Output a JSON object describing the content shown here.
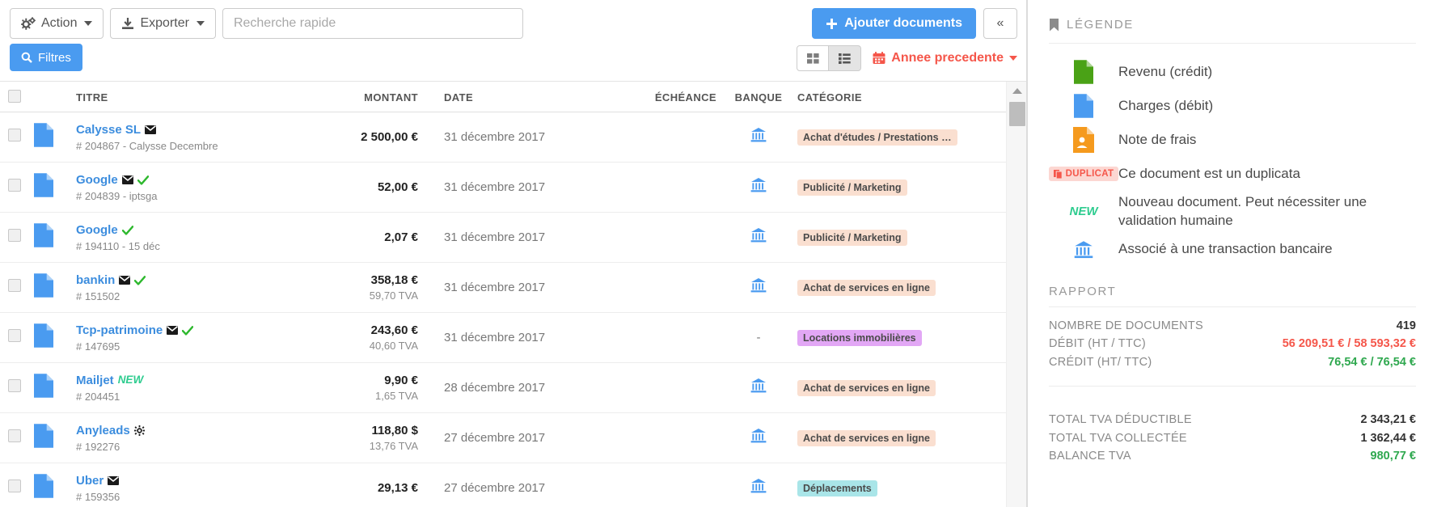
{
  "toolbar": {
    "action_label": "Action",
    "export_label": "Exporter",
    "search_placeholder": "Recherche rapide",
    "search_value": "",
    "add_documents_label": "Ajouter documents",
    "collapse_label": "«"
  },
  "filterbar": {
    "filter_label": "Filtres",
    "year_label": "Annee precedente",
    "view_grid": "grid-view",
    "view_list": "list-view"
  },
  "table": {
    "columns": [
      "TITRE",
      "MONTANT",
      "DATE",
      "ÉCHÉANCE",
      "BANQUE",
      "CATÉGORIE"
    ],
    "rows": [
      {
        "title": "Calysse SL",
        "flags": [
          "mail"
        ],
        "ref": "# 204867 -  Calysse Decembre",
        "amount": "2 500,00 €",
        "tva": "",
        "date": "31 décembre 2017",
        "echeance": "",
        "bank": "bank",
        "category": "Achat d'études / Prestations …",
        "category_color": "#fadfd0"
      },
      {
        "title": "Google",
        "flags": [
          "mail",
          "check"
        ],
        "ref": "# 204839 -  iptsga",
        "amount": "52,00 €",
        "tva": "",
        "date": "31 décembre 2017",
        "echeance": "",
        "bank": "bank",
        "category": "Publicité / Marketing",
        "category_color": "#fadfd0"
      },
      {
        "title": "Google",
        "flags": [
          "check"
        ],
        "ref": "# 194110 -  15 déc",
        "amount": "2,07 €",
        "tva": "",
        "date": "31 décembre 2017",
        "echeance": "",
        "bank": "bank",
        "category": "Publicité / Marketing",
        "category_color": "#fadfd0"
      },
      {
        "title": "bankin",
        "flags": [
          "mail",
          "check"
        ],
        "ref": "# 151502",
        "amount": "358,18 €",
        "tva": "59,70 TVA",
        "date": "31 décembre 2017",
        "echeance": "",
        "bank": "bank",
        "category": "Achat de services en ligne",
        "category_color": "#fadfd0"
      },
      {
        "title": "Tcp-patrimoine",
        "flags": [
          "mail",
          "check"
        ],
        "ref": "# 147695",
        "amount": "243,60 €",
        "tva": "40,60 TVA",
        "date": "31 décembre 2017",
        "echeance": "",
        "bank": "none",
        "category": "Locations immobilières",
        "category_color": "#e2a7f5"
      },
      {
        "title": "Mailjet",
        "flags": [
          "new"
        ],
        "ref": "# 204451",
        "amount": "9,90 €",
        "tva": "1,65 TVA",
        "date": "28 décembre 2017",
        "echeance": "",
        "bank": "bank",
        "category": "Achat de services en ligne",
        "category_color": "#fadfd0"
      },
      {
        "title": "Anyleads",
        "flags": [
          "gear"
        ],
        "ref": "# 192276",
        "amount": "118,80 $",
        "tva": "13,76 TVA",
        "date": "27 décembre 2017",
        "echeance": "",
        "bank": "bank",
        "category": "Achat de services en ligne",
        "category_color": "#fadfd0"
      },
      {
        "title": "Uber",
        "flags": [
          "mail"
        ],
        "ref": "# 159356",
        "amount": "29,13 €",
        "tva": "",
        "date": "27 décembre 2017",
        "echeance": "",
        "bank": "bank",
        "category": "Déplacements",
        "category_color": "#a9e5e8"
      }
    ]
  },
  "panel": {
    "legend_title": "LÉGENDE",
    "legend_items": [
      {
        "icon": "document-green-icon",
        "text": "Revenu (crédit)"
      },
      {
        "icon": "document-blue-icon",
        "text": "Charges (débit)"
      },
      {
        "icon": "document-orange-icon",
        "text": "Note de frais"
      },
      {
        "icon": "duplicat-badge",
        "badge": "DUPLICAT",
        "text": "Ce document est un duplicata"
      },
      {
        "icon": "new-badge",
        "badge": "NEW",
        "text": "Nouveau document. Peut nécessiter une validation humaine"
      },
      {
        "icon": "bank-icon",
        "text": "Associé à une transaction bancaire"
      }
    ],
    "rapport_title": "RAPPORT",
    "rapport_rows_top": [
      {
        "label": "NOMBRE DE DOCUMENTS",
        "value": "419",
        "color": "default"
      },
      {
        "label": "DÉBIT (HT / TTC)",
        "value": "56 209,51 € / 58 593,32 €",
        "color": "red"
      },
      {
        "label": "CRÉDIT (HT/ TTC)",
        "value": "76,54 € / 76,54 €",
        "color": "green"
      }
    ],
    "rapport_rows_bottom": [
      {
        "label": "TOTAL TVA DÉDUCTIBLE",
        "value": "2 343,21 €",
        "color": "default"
      },
      {
        "label": "TOTAL TVA COLLECTÉE",
        "value": "1 362,44 €",
        "color": "default"
      },
      {
        "label": "BALANCE TVA",
        "value": "980,77 €",
        "color": "green"
      }
    ]
  },
  "colors": {
    "primary": "#4a9bf0",
    "danger": "#f5564a",
    "success": "#2ecc8f",
    "doc_blue": "#4a9bf0",
    "doc_green": "#4aa216",
    "doc_orange": "#f59a1e"
  }
}
